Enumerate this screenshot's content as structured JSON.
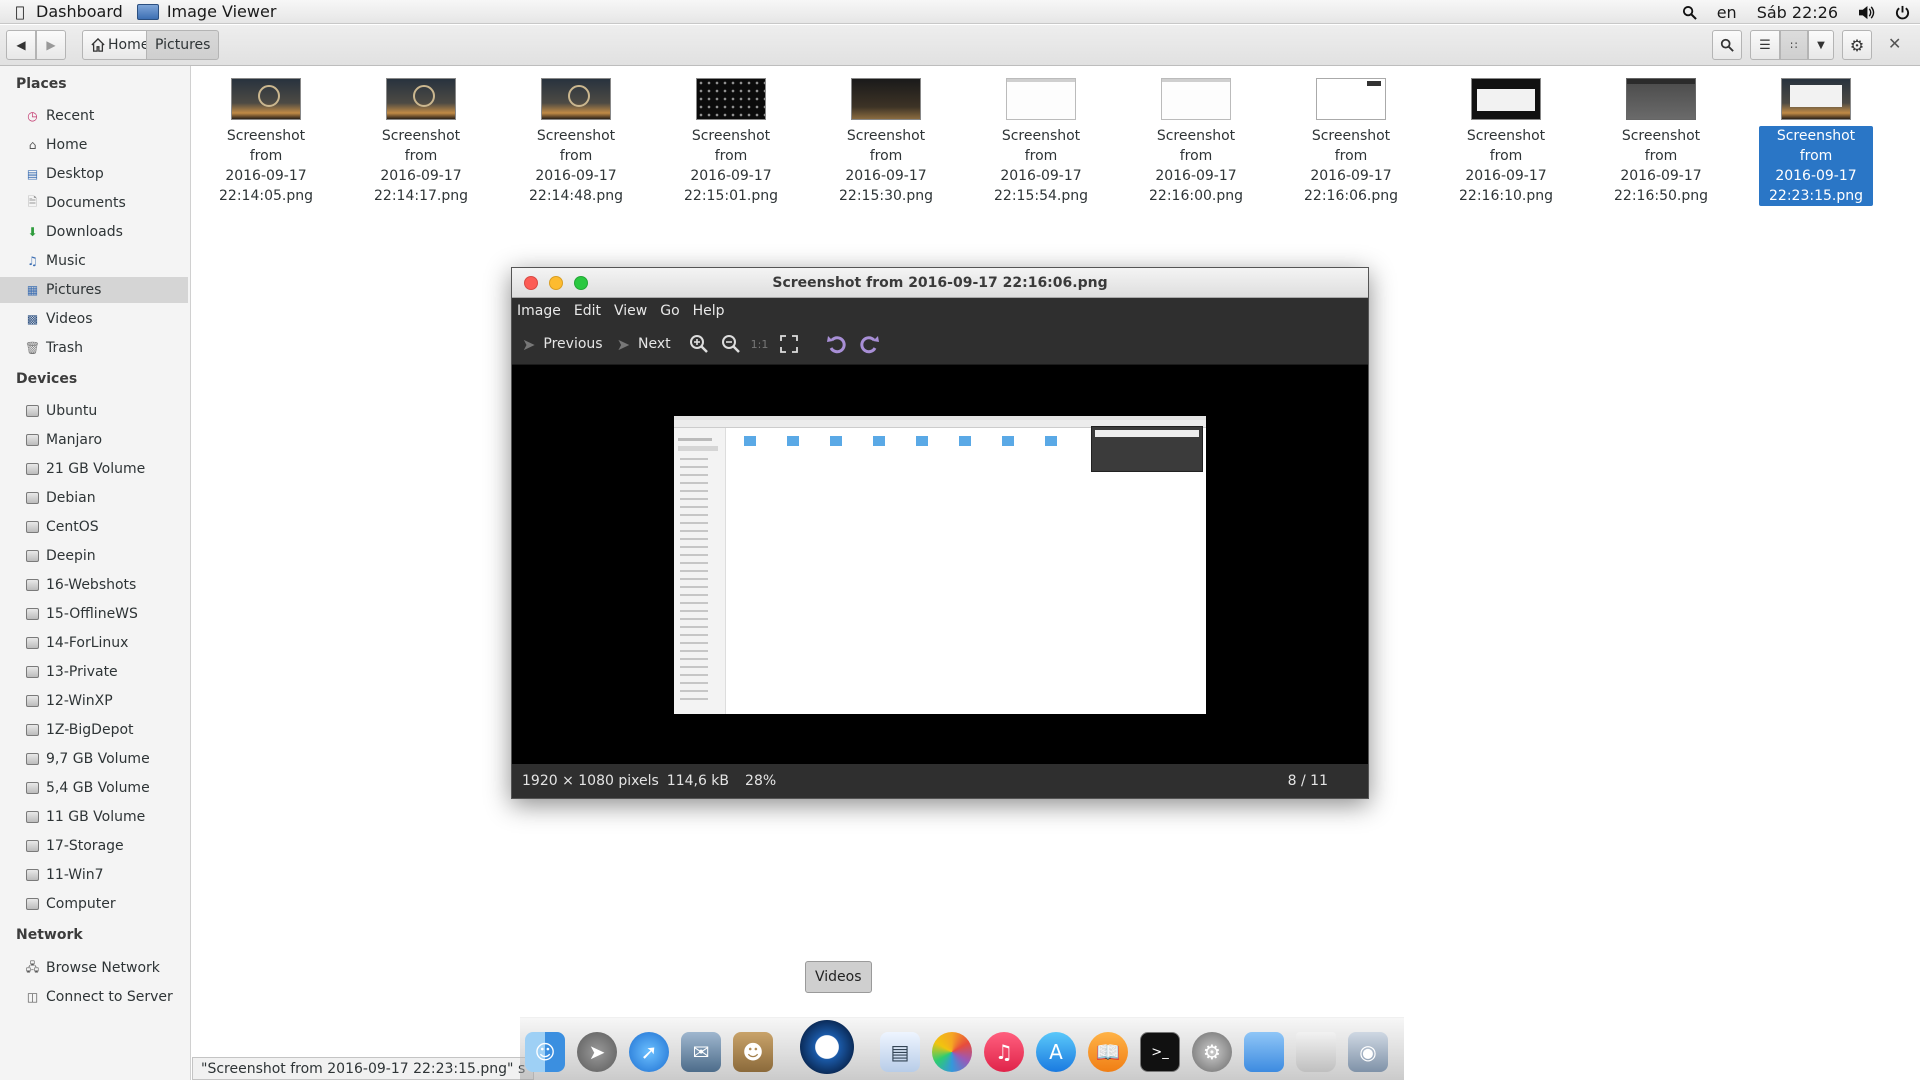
{
  "top_panel": {
    "dashboard_label": "Dashboard",
    "app_label": "Image Viewer",
    "language": "en",
    "clock": "Sáb 22:26"
  },
  "header": {
    "crumb_home": "Home",
    "crumb_pictures": "Pictures"
  },
  "sidebar": {
    "places_heading": "Places",
    "places": [
      "Recent",
      "Home",
      "Desktop",
      "Documents",
      "Downloads",
      "Music",
      "Pictures",
      "Videos",
      "Trash"
    ],
    "devices_heading": "Devices",
    "devices": [
      "Ubuntu",
      "Manjaro",
      "21 GB Volume",
      "Debian",
      "CentOS",
      "Deepin",
      "16-Webshots",
      "15-OfflineWS",
      "14-ForLinux",
      "13-Private",
      "12-WinXP",
      "1Z-BigDepot",
      "9,7 GB Volume",
      "5,4 GB Volume",
      "11 GB Volume",
      "17-Storage",
      "11-Win7",
      "Computer"
    ],
    "network_heading": "Network",
    "network": [
      "Browse Network",
      "Connect to Server"
    ],
    "selected": "Pictures"
  },
  "files": [
    {
      "line1": "Screenshot from",
      "line2": "2016-09-17",
      "line3": "22:14:05.png",
      "thumb": "night"
    },
    {
      "line1": "Screenshot from",
      "line2": "2016-09-17",
      "line3": "22:14:17.png",
      "thumb": "night"
    },
    {
      "line1": "Screenshot from",
      "line2": "2016-09-17",
      "line3": "22:14:48.png",
      "thumb": "night"
    },
    {
      "line1": "Screenshot from",
      "line2": "2016-09-17",
      "line3": "22:15:01.png",
      "thumb": "dots"
    },
    {
      "line1": "Screenshot from",
      "line2": "2016-09-17",
      "line3": "22:15:30.png",
      "thumb": "sky"
    },
    {
      "line1": "Screenshot from",
      "line2": "2016-09-17",
      "line3": "22:15:54.png",
      "thumb": "white"
    },
    {
      "line1": "Screenshot from",
      "line2": "2016-09-17",
      "line3": "22:16:00.png",
      "thumb": "white"
    },
    {
      "line1": "Screenshot from",
      "line2": "2016-09-17",
      "line3": "22:16:06.png",
      "thumb": "whitebar"
    },
    {
      "line1": "Screenshot from",
      "line2": "2016-09-17",
      "line3": "22:16:10.png",
      "thumb": "blackwin"
    },
    {
      "line1": "Screenshot from",
      "line2": "2016-09-17",
      "line3": "22:16:50.png",
      "thumb": "gray"
    },
    {
      "line1": "Screenshot from",
      "line2": "2016-09-17",
      "line3": "22:23:15.png",
      "thumb": "mixed",
      "selected": true
    }
  ],
  "viewer": {
    "title": "Screenshot from 2016-09-17 22:16:06.png",
    "menu": [
      "Image",
      "Edit",
      "View",
      "Go",
      "Help"
    ],
    "previous_label": "Previous",
    "next_label": "Next",
    "zoom_normal_label": "1:1",
    "status_dimensions": "1920 × 1080 pixels",
    "status_size": "114,6 kB",
    "status_zoom": "28%",
    "status_position": "8 / 11"
  },
  "tooltip": "Videos",
  "fm_status": "\"Screenshot from 2016-09-17 22:23:15.png\" s",
  "colors": {
    "selection": "#2a76c6",
    "viewer_bg": "#2f2f2f",
    "close": "#fc5c55",
    "minimize": "#fdbb2f",
    "maximize": "#2ac840"
  },
  "dock_icons": [
    "finder-icon",
    "launchpad-icon",
    "safari-icon",
    "mail-icon",
    "contacts-icon",
    "quicktime-icon",
    "preview-icon",
    "photos-icon",
    "itunes-icon",
    "app-store-icon",
    "ibooks-icon",
    "terminal-icon",
    "system-preferences-icon",
    "folder-icon",
    "trash-icon",
    "image-viewer-icon"
  ]
}
